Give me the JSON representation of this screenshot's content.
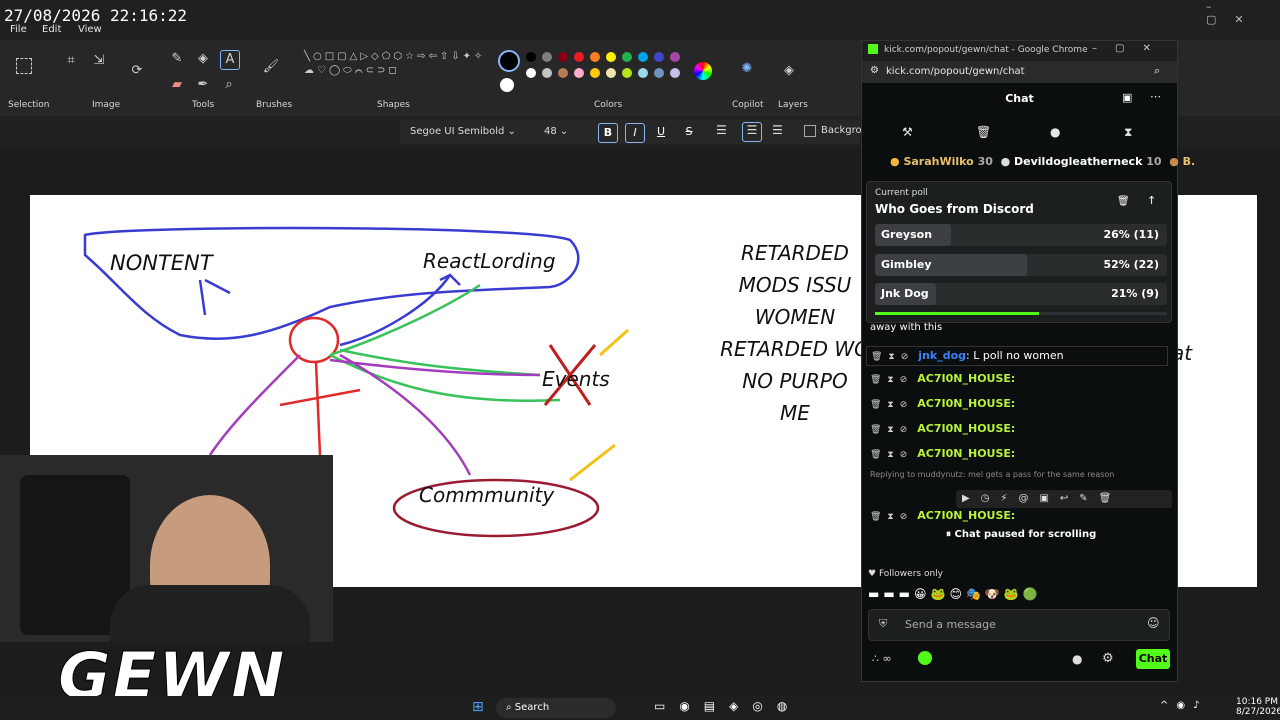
{
  "overlay": {
    "timestamp": "27/08/2026 22:16:22",
    "brand": "GEWN"
  },
  "paint": {
    "menus": [
      "File",
      "Edit",
      "View"
    ],
    "groups": {
      "selection": "Selection",
      "image": "Image",
      "tools": "Tools",
      "brushes": "Brushes",
      "shapes": "Shapes",
      "colors": "Colors",
      "copilot": "Copilot",
      "layers": "Layers"
    },
    "text_toolbar": {
      "font": "Segoe UI Semibold",
      "size": "48",
      "bold": "B",
      "italic": "I",
      "underline": "U",
      "strike": "S",
      "background": "Backgrou"
    },
    "palette": [
      "#000000",
      "#7f7f7f",
      "#880015",
      "#ed1c24",
      "#ff7f27",
      "#fff200",
      "#22b14c",
      "#00a2e8",
      "#3f48cc",
      "#a349a4",
      "#ffffff",
      "#c3c3c3",
      "#b97a57",
      "#ffaec9",
      "#ffc90e",
      "#efe4b0",
      "#b5e61d",
      "#99d9ea",
      "#7092be",
      "#c8bfe7"
    ],
    "canvas_labels": {
      "nontent": "NONTENT",
      "reactlording": "ReactLording",
      "events": "Events",
      "community": "Commmunity"
    },
    "canvas_right_lines": [
      "RETARDED",
      "MODS ISSU",
      "WOMEN",
      "RETARDED WO",
      "NO PURPO",
      "ME"
    ],
    "canvas_far_right": [
      "at"
    ]
  },
  "chrome": {
    "title": "kick.com/popout/gewn/chat - Google Chrome",
    "url": "kick.com/popout/gewn/chat",
    "header": "Chat",
    "top_gifters": [
      {
        "name": "SarahWilko",
        "count": "30"
      },
      {
        "name": "Devildogleatherneck",
        "count": "10"
      },
      {
        "name": "B.",
        "count": ""
      }
    ],
    "poll": {
      "label": "Current poll",
      "question": "Who Goes from Discord",
      "options": [
        {
          "name": "Greyson",
          "value": "26% (11)",
          "pct": 26
        },
        {
          "name": "Gimbley",
          "value": "52% (22)",
          "pct": 52
        },
        {
          "name": "Jnk Dog",
          "value": "21% (9)",
          "pct": 21
        }
      ],
      "progress": 0.56
    },
    "partial_line": "away with this",
    "messages": [
      {
        "user": "jnk_dog",
        "text": "L poll no women",
        "color": "#3b82f6"
      },
      {
        "user": "AC7I0N_HOUSE:",
        "text": ""
      },
      {
        "user": "AC7I0N_HOUSE:",
        "text": ""
      },
      {
        "user": "AC7I0N_HOUSE:",
        "text": ""
      },
      {
        "user": "AC7I0N_HOUSE:",
        "text": ""
      }
    ],
    "reply_line": "Replying to muddynutz: mel gets a pass for the same reason",
    "last_user": "AC7I0N_HOUSE:",
    "paused": "Chat paused for scrolling",
    "followers_only": "Followers only",
    "input_placeholder": "Send a message",
    "chat_button": "Chat"
  },
  "taskbar": {
    "search": "Search",
    "time": "10:16 PM",
    "date": "8/27/2026"
  }
}
